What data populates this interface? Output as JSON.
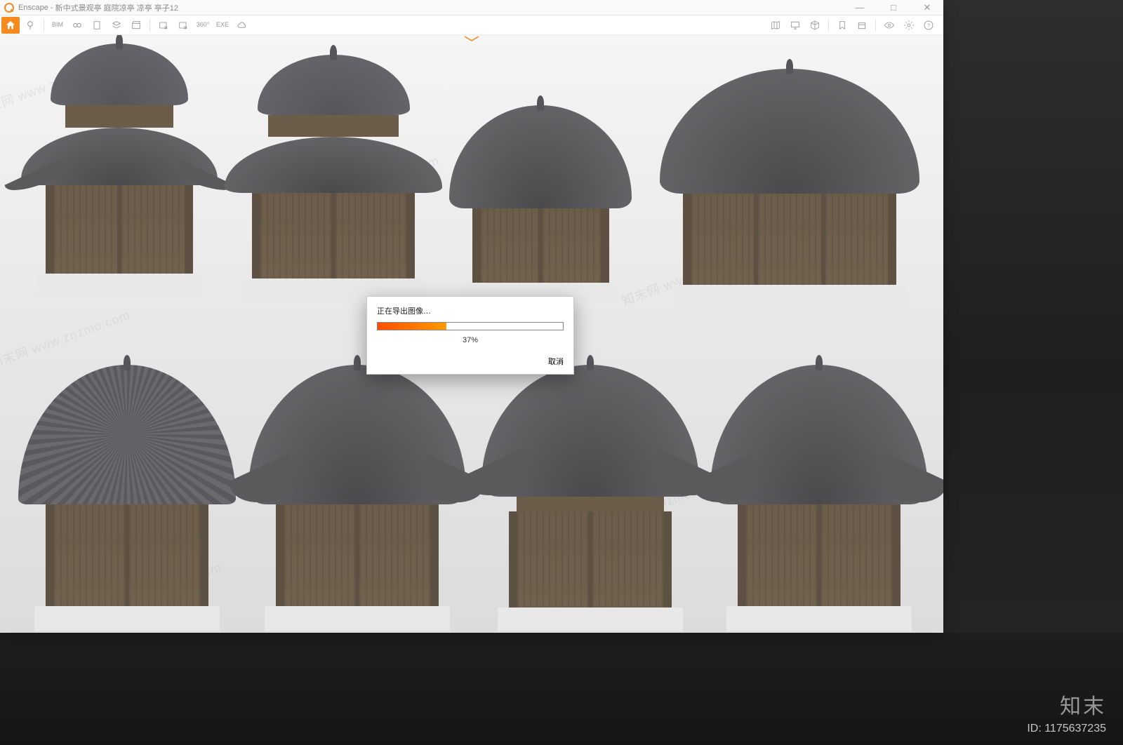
{
  "app": {
    "name": "Enscape",
    "title_suffix": "新中式景观亭 庭院凉亭 凉亭 亭子12"
  },
  "window_controls": {
    "minimize": "—",
    "maximize": "□",
    "close": "✕"
  },
  "toolbar": {
    "left_items": [
      {
        "name": "home",
        "label": ""
      },
      {
        "name": "pin",
        "label": ""
      },
      {
        "name": "bim",
        "label": "BIM"
      },
      {
        "name": "view-sync",
        "label": ""
      },
      {
        "name": "doc",
        "label": ""
      },
      {
        "name": "layers",
        "label": ""
      },
      {
        "name": "video",
        "label": ""
      },
      {
        "name": "capture-in",
        "label": ""
      },
      {
        "name": "capture-out",
        "label": ""
      },
      {
        "name": "pano",
        "label": "360°"
      },
      {
        "name": "exe",
        "label": "EXE"
      },
      {
        "name": "cloud",
        "label": ""
      }
    ],
    "right_items": [
      {
        "name": "map",
        "label": ""
      },
      {
        "name": "display",
        "label": ""
      },
      {
        "name": "cube",
        "label": ""
      },
      {
        "name": "bookmark",
        "label": ""
      },
      {
        "name": "assets",
        "label": ""
      },
      {
        "name": "visibility",
        "label": ""
      },
      {
        "name": "settings",
        "label": ""
      },
      {
        "name": "help",
        "label": "?"
      }
    ]
  },
  "export_dialog": {
    "title": "正在导出图像…",
    "progress_percent": 37,
    "progress_label": "37%",
    "cancel": "取消"
  },
  "watermark": {
    "brand": "知末",
    "id_label": "ID: 1175637235",
    "repeat_text": "知末网 www.znzmo.com"
  }
}
